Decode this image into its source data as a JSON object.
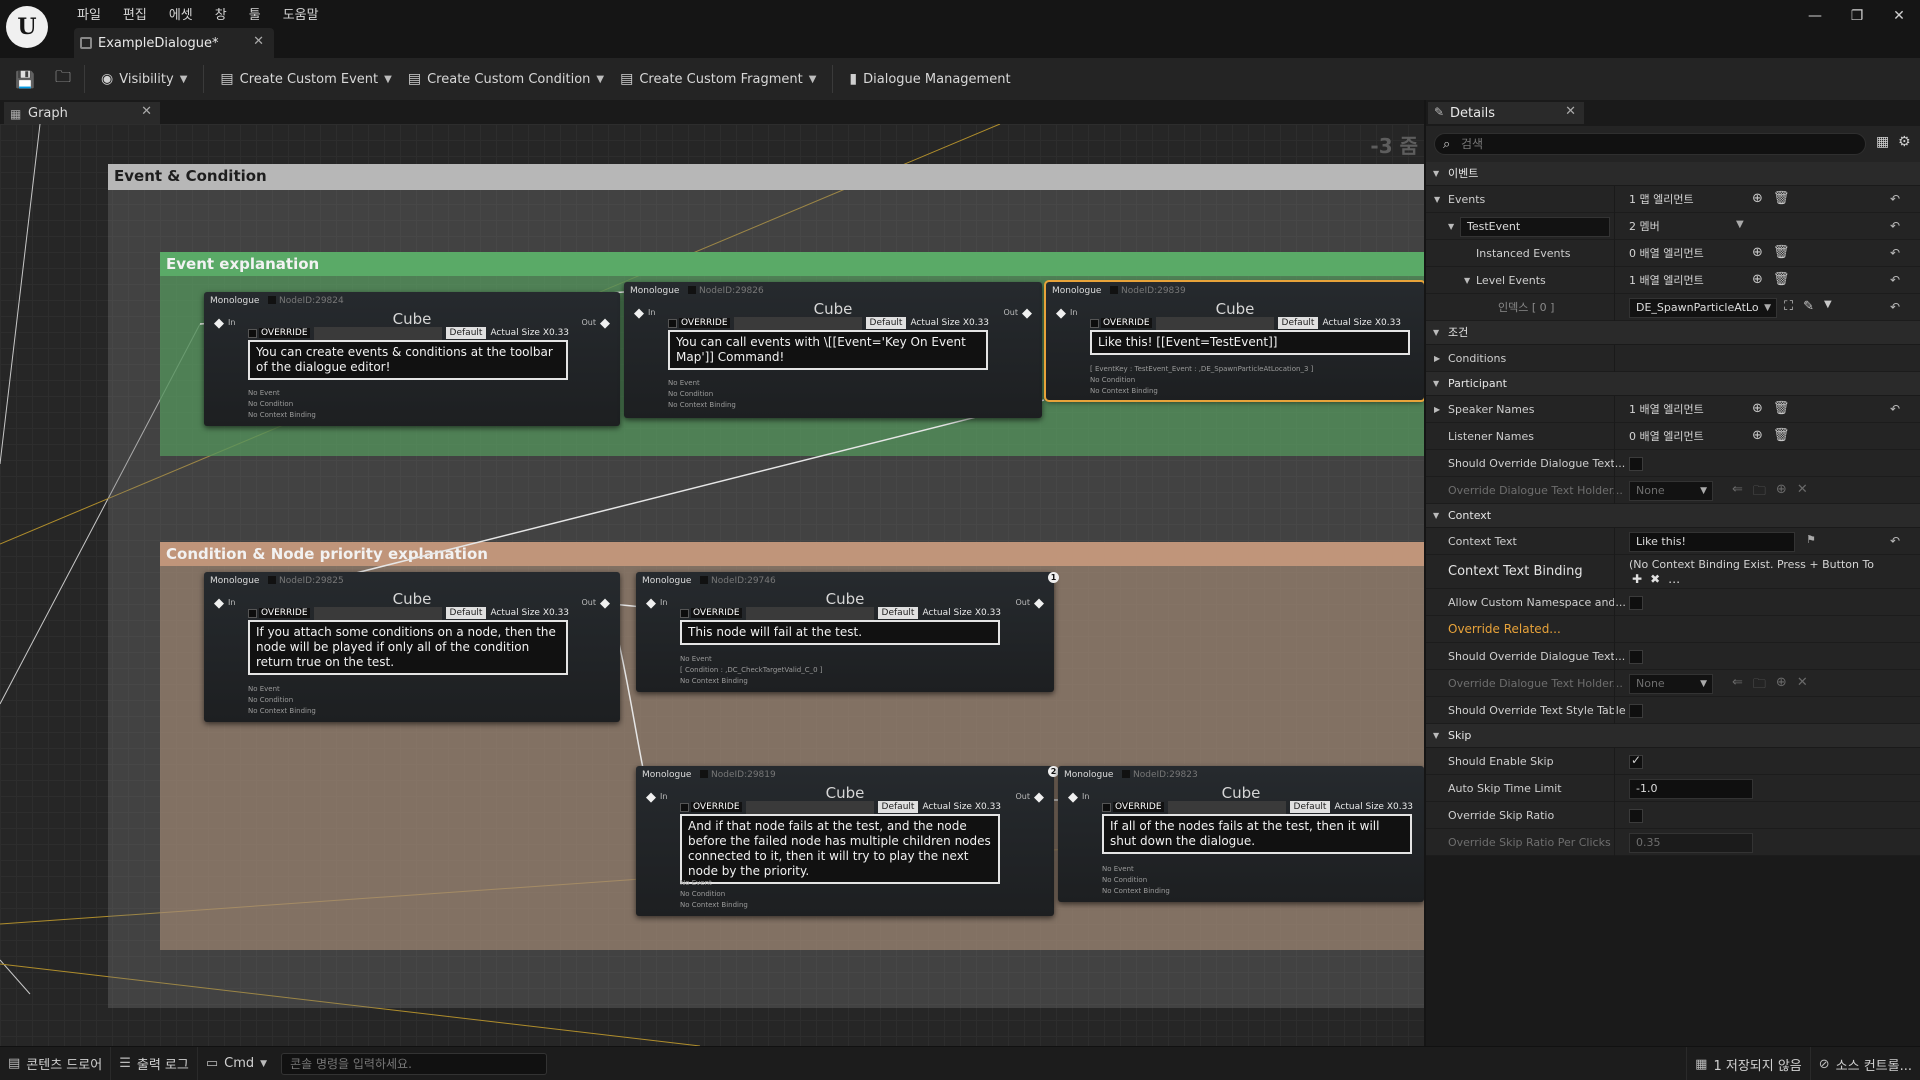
{
  "app": {
    "logo": "U",
    "menu": [
      "파일",
      "편집",
      "에셋",
      "창",
      "툴",
      "도움말"
    ],
    "document_tab": "ExampleDialogue*",
    "window_controls": [
      "—",
      "❐",
      "✕"
    ]
  },
  "toolbar": {
    "visibility": "Visibility",
    "create_event": "Create Custom Event",
    "create_condition": "Create Custom Condition",
    "create_fragment": "Create Custom Fragment",
    "dialogue_management": "Dialogue Management"
  },
  "graph": {
    "tab_label": "Graph",
    "zoom_label": "-3 줌",
    "comments": {
      "outer": "Event & Condition",
      "event": "Event explanation",
      "condition": "Condition & Node priority explanation"
    },
    "node_common": {
      "type": "Monologue",
      "speaker": "Cube",
      "pin_in": "In",
      "pin_out": "Out",
      "override": "OVERRIDE",
      "default": "Default",
      "actual_size": "Actual Size X0.33"
    },
    "nodes": [
      {
        "id": "NodeID:29824",
        "text": "You can create events & conditions at the toolbar of the dialogue editor!",
        "foot": [
          "No Event",
          "No Condition",
          "No Context Binding"
        ]
      },
      {
        "id": "NodeID:29826",
        "text": "You can call events with \\[[Event='Key On Event Map']] Command!",
        "foot": [
          "No Event",
          "No Condition",
          "No Context Binding"
        ]
      },
      {
        "id": "NodeID:29839",
        "text": "Like this! [[Event=TestEvent]]",
        "foot": [
          "[ EventKey : TestEvent_Event : ,DE_SpawnParticleAtLocation_3 ]",
          "No Condition",
          "No Context Binding"
        ]
      },
      {
        "id": "NodeID:29825",
        "text": "If you attach some conditions on a node, then the node will be played if only all of the condition return true on the test.",
        "foot": [
          "No Event",
          "No Condition",
          "No Context Binding"
        ]
      },
      {
        "id": "NodeID:29746",
        "text": "This node will fail at the test.",
        "foot": [
          "No Event",
          "[ Condition : ,DC_CheckTargetValid_C_0 ]",
          "No Context Binding"
        ],
        "badge": "1"
      },
      {
        "id": "NodeID:29819",
        "text": "And if that node fails at the test, and the node before the failed node has multiple children nodes connected to it, then it will try to play the next node by the priority.",
        "foot": [
          "No Event",
          "No Condition",
          "No Context Binding"
        ],
        "badge": "2"
      },
      {
        "id": "NodeID:29823",
        "text": "If all of the nodes fails at the test, then it will shut down the dialogue.",
        "foot": [
          "No Event",
          "No Condition",
          "No Context Binding"
        ]
      }
    ]
  },
  "details": {
    "tab_label": "Details",
    "search_placeholder": "검색",
    "sections": {
      "event": "이벤트",
      "condition": "조건",
      "participant": "Participant",
      "context": "Context",
      "skip": "Skip"
    },
    "events": {
      "label": "Events",
      "value": "1 맵 엘리먼트",
      "key": "TestEvent",
      "key_value": "2 멤버",
      "instanced_label": "Instanced Events",
      "instanced_value": "0 배열 엘리먼트",
      "level_label": "Level Events",
      "level_value": "1 배열 엘리먼트",
      "index_label": "인덱스 [ 0 ]",
      "index_value": "DE_SpawnParticleAtLo"
    },
    "conditions": {
      "label": "Conditions"
    },
    "participant": {
      "speaker_label": "Speaker Names",
      "speaker_value": "1 배열 엘리먼트",
      "listener_label": "Listener Names",
      "listener_value": "0 배열 엘리먼트",
      "override_text_label": "Should Override Dialogue Text...",
      "holder_label": "Override Dialogue Text Holder...",
      "holder_value": "None"
    },
    "context": {
      "text_label": "Context Text",
      "text_value": "Like this! [[Event=TestEvent]]",
      "binding_label": "Context Text Binding",
      "binding_value": "(No Context Binding Exist. Press + Button To",
      "allow_ns_label": "Allow Custom Namespace and...",
      "override_related": "Override Related...",
      "override_text_label": "Should Override Dialogue Text...",
      "holder_label": "Override Dialogue Text Holder...",
      "holder_value": "None",
      "style_table_label": "Should Override Text Style Table"
    },
    "skip": {
      "enable_label": "Should Enable Skip",
      "enable_value": true,
      "auto_label": "Auto Skip Time Limit",
      "auto_value": "-1.0",
      "ratio_label": "Override Skip Ratio",
      "per_click_label": "Override Skip Ratio Per Clicks",
      "per_click_value": "0.35"
    }
  },
  "statusbar": {
    "content_drawer": "콘텐츠 드로어",
    "output_log": "출력 로그",
    "cmd": "Cmd",
    "console_placeholder": "콘솔 명령을 입력하세요.",
    "unsaved": "1 저장되지 않음",
    "source_control": "소스 컨트롤..."
  },
  "colors": {
    "event_comment": "#5aaa67",
    "condition_comment": "#c0957a",
    "outer_comment": "#b7b7b7",
    "selected_outline": "#e8a33a",
    "override_related": "#e8a33a"
  }
}
